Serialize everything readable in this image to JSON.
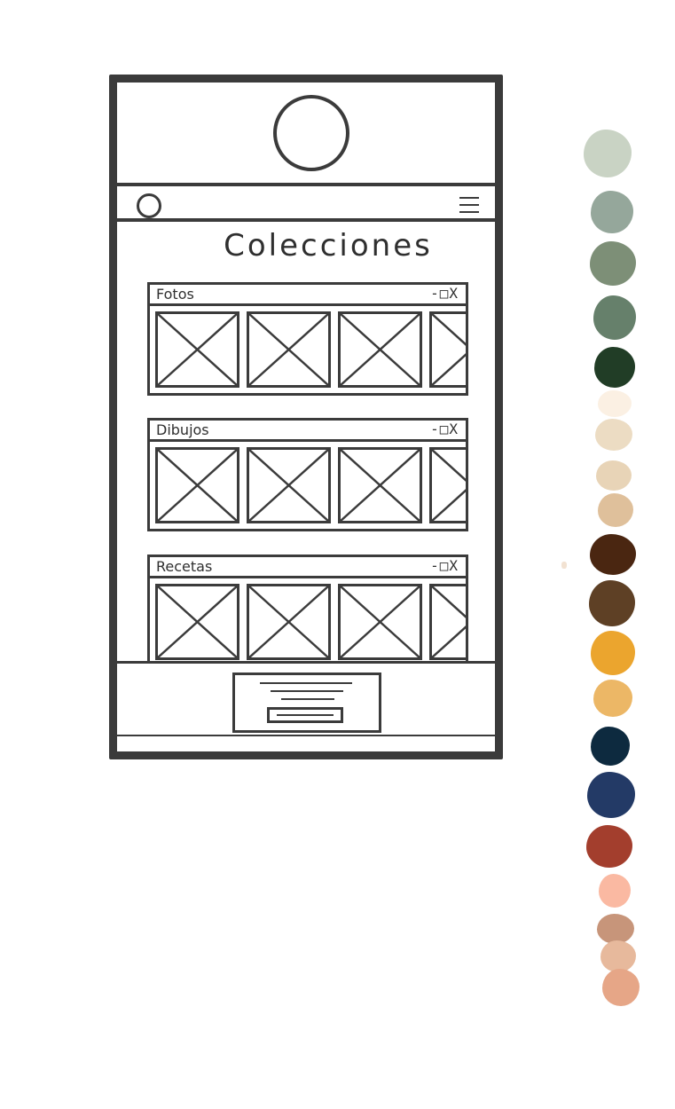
{
  "page": {
    "title": "Colecciones"
  },
  "collections": [
    {
      "title": "Fotos",
      "controls": "-□X"
    },
    {
      "title": "Dibujos",
      "controls": "-□X"
    },
    {
      "title": "Recetas",
      "controls": "-□X"
    }
  ],
  "palette": {
    "colors": [
      "#c9d3c4",
      "#95a79b",
      "#7d8f77",
      "#66806b",
      "#213d26",
      "#fbf0e3",
      "#ecdcc3",
      "#e8d4b7",
      "#dfc09b",
      "#4a2611",
      "#5e4025",
      "#eba52e",
      "#ecb766",
      "#0d2a3f",
      "#233a66",
      "#a33e2d",
      "#fab9a2",
      "#c7957a",
      "#e7b99c",
      "#e6a687"
    ]
  }
}
